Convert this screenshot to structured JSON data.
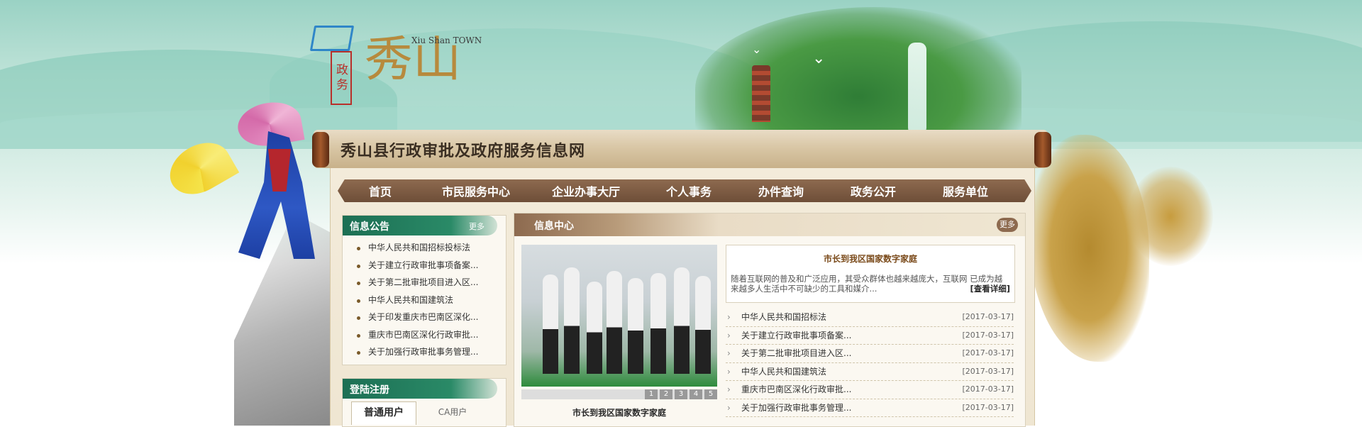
{
  "logo": {
    "seal": "政务",
    "char": "秀山",
    "english": "Xiu Shan TOWN"
  },
  "site_title": "秀山县行政审批及政府服务信息网",
  "nav": [
    "首页",
    "市民服务中心",
    "企业办事大厅",
    "个人事务",
    "办件查询",
    "政务公开",
    "服务单位"
  ],
  "notice": {
    "title": "信息公告",
    "more": "更多",
    "items": [
      "中华人民共和国招标投标法",
      "关于建立行政审批事项备案...",
      "关于第二批审批项目进入区...",
      "中华人民共和国建筑法",
      "关于印发重庆市巴南区深化...",
      "重庆市巴南区深化行政审批...",
      "关于加强行政审批事务管理..."
    ]
  },
  "login": {
    "title": "登陆注册",
    "tab_active": "普通用户",
    "tab_other": "CA用户"
  },
  "info": {
    "title": "信息中心",
    "more": "更多",
    "photo_caption": "市长到我区国家数字家庭",
    "slide_numbers": [
      "1",
      "2",
      "3",
      "4",
      "5"
    ],
    "feature": {
      "title": "市长到我区国家数字家庭",
      "body": "随着互联网的普及和广泛应用，其受众群体也越来越庞大，互联网 已成为越来越多人生活中不可缺少的工具和媒介...",
      "more": "[查看详细]"
    },
    "news": [
      {
        "title": "中华人民共和国招标法",
        "date": "[2017-03-17]"
      },
      {
        "title": "关于建立行政审批事项备案...",
        "date": "[2017-03-17]"
      },
      {
        "title": "关于第二批审批项目进入区...",
        "date": "[2017-03-17]"
      },
      {
        "title": "中华人民共和国建筑法",
        "date": "[2017-03-17]"
      },
      {
        "title": "重庆市巴南区深化行政审批...",
        "date": "[2017-03-17]"
      },
      {
        "title": "关于加强行政审批事务管理...",
        "date": "[2017-03-17]"
      }
    ]
  }
}
